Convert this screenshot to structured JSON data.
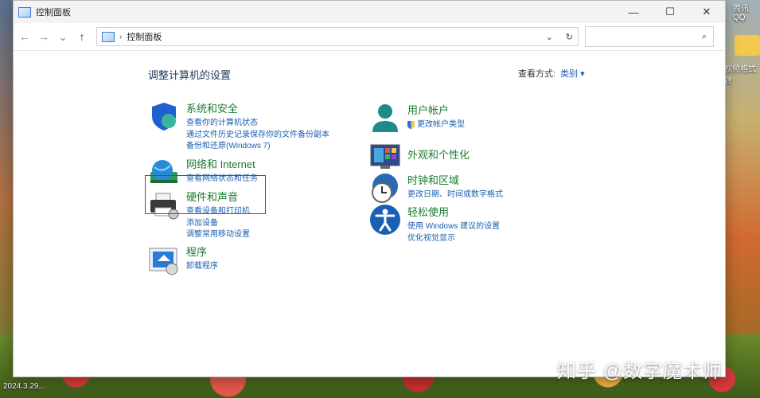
{
  "desktop": {
    "top_right_label": "腾讯QQ",
    "right_label": "视频格式转",
    "bottom_left_date": "2024.3.29..."
  },
  "window": {
    "title": "控制面板",
    "controls": {
      "minimize": "—",
      "maximize": "☐",
      "close": "✕"
    }
  },
  "navbar": {
    "back": "←",
    "forward": "→",
    "recent": "⌄",
    "up": "↑",
    "breadcrumb_sep": "›",
    "breadcrumb": "控制面板",
    "dropdown": "⌄",
    "refresh": "↻",
    "search_value": "",
    "search_icon": "⌕"
  },
  "content": {
    "heading": "调整计算机的设置",
    "view_by_label": "查看方式:",
    "view_by_value": "类别 ▾"
  },
  "categories_left": [
    {
      "title": "系统和安全",
      "icon": "shield-icon",
      "links": [
        "查看你的计算机状态",
        "通过文件历史记录保存你的文件备份副本",
        "备份和还原(Windows 7)"
      ]
    },
    {
      "title": "网络和 Internet",
      "icon": "globe-network-icon",
      "links": [
        "查看网络状态和任务"
      ]
    },
    {
      "title": "硬件和声音",
      "icon": "printer-icon",
      "links": [
        "查看设备和打印机",
        "添加设备",
        "调整常用移动设置"
      ]
    },
    {
      "title": "程序",
      "icon": "programs-icon",
      "links": [
        "卸载程序"
      ]
    }
  ],
  "categories_right": [
    {
      "title": "用户帐户",
      "icon": "user-icon",
      "links": [
        "更改帐户类型"
      ]
    },
    {
      "title": "外观和个性化",
      "icon": "monitor-icon",
      "links": []
    },
    {
      "title": "时钟和区域",
      "icon": "clock-globe-icon",
      "links": [
        "更改日期、时间或数字格式"
      ]
    },
    {
      "title": "轻松使用",
      "icon": "accessibility-icon",
      "links": [
        "使用 Windows 建议的设置",
        "优化视觉显示"
      ]
    }
  ],
  "watermark": "知乎 @数字魔术师",
  "colors": {
    "category_title": "#1a7a2e",
    "link": "#1a5fb4",
    "highlight": "#cc2222"
  }
}
